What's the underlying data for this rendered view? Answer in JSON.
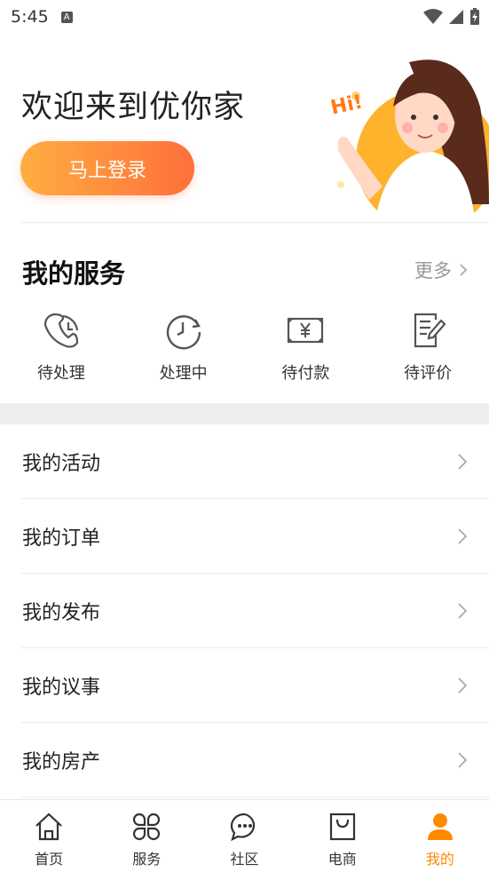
{
  "status_bar": {
    "time": "5:45",
    "badge": "A"
  },
  "hero": {
    "welcome": "欢迎来到优你家",
    "login_label": "马上登录",
    "hi_text": "Hi!"
  },
  "services": {
    "title": "我的服务",
    "more_label": "更多",
    "items": [
      {
        "label": "待处理",
        "icon": "phone-clock-icon"
      },
      {
        "label": "处理中",
        "icon": "clock-icon"
      },
      {
        "label": "待付款",
        "icon": "yen-bill-icon"
      },
      {
        "label": "待评价",
        "icon": "edit-document-icon"
      }
    ]
  },
  "menu": {
    "items": [
      {
        "label": "我的活动"
      },
      {
        "label": "我的订单"
      },
      {
        "label": "我的发布"
      },
      {
        "label": "我的议事"
      },
      {
        "label": "我的房产"
      }
    ]
  },
  "tabbar": {
    "active_color": "#ff8a00",
    "items": [
      {
        "label": "首页",
        "icon": "home-icon"
      },
      {
        "label": "服务",
        "icon": "grid-clover-icon"
      },
      {
        "label": "社区",
        "icon": "chat-bubble-icon"
      },
      {
        "label": "电商",
        "icon": "shopping-bag-icon"
      },
      {
        "label": "我的",
        "icon": "person-icon",
        "active": true
      }
    ]
  }
}
